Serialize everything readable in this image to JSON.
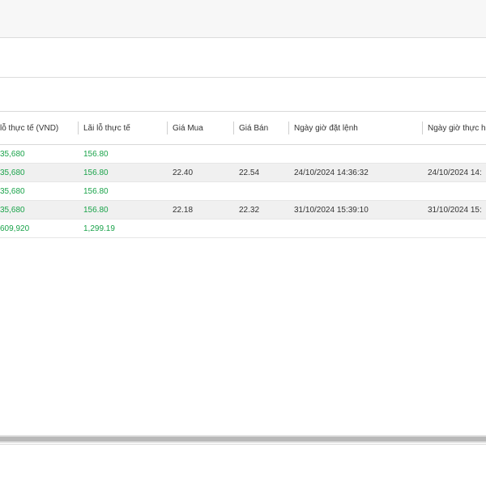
{
  "table": {
    "columns": [
      "lỗ thực tế (VND)",
      "Lãi lỗ thực tế",
      "Giá Mua",
      "Giá Bán",
      "Ngày giờ đặt lệnh",
      "Ngày giờ thực h"
    ],
    "rows": [
      {
        "pl_vnd": "35,680",
        "pl": "156.80",
        "buy": "",
        "sell": "",
        "order_time": "",
        "exec_time": "",
        "alt": false
      },
      {
        "pl_vnd": "35,680",
        "pl": "156.80",
        "buy": "22.40",
        "sell": "22.54",
        "order_time": "24/10/2024 14:36:32",
        "exec_time": "24/10/2024 14:",
        "alt": true
      },
      {
        "pl_vnd": "35,680",
        "pl": "156.80",
        "buy": "",
        "sell": "",
        "order_time": "",
        "exec_time": "",
        "alt": false
      },
      {
        "pl_vnd": "35,680",
        "pl": "156.80",
        "buy": "22.18",
        "sell": "22.32",
        "order_time": "31/10/2024 15:39:10",
        "exec_time": "31/10/2024 15:",
        "alt": true
      },
      {
        "pl_vnd": "609,920",
        "pl": "1,299.19",
        "buy": "",
        "sell": "",
        "order_time": "",
        "exec_time": "",
        "alt": false
      }
    ]
  },
  "colors": {
    "profit_green": "#1aa34a",
    "alt_row": "#f0f0f0",
    "border": "#d9d9d9"
  }
}
